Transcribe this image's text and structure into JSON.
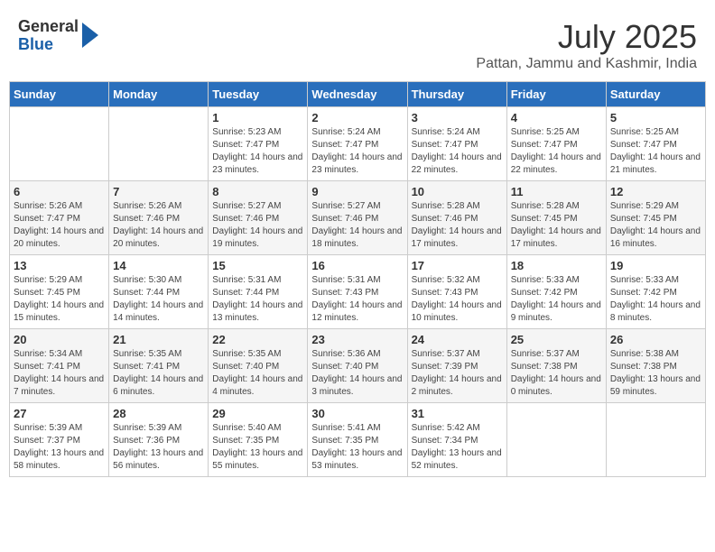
{
  "header": {
    "logo_general": "General",
    "logo_blue": "Blue",
    "title": "July 2025",
    "location": "Pattan, Jammu and Kashmir, India"
  },
  "calendar": {
    "days_of_week": [
      "Sunday",
      "Monday",
      "Tuesday",
      "Wednesday",
      "Thursday",
      "Friday",
      "Saturday"
    ],
    "weeks": [
      [
        {
          "day": "",
          "info": ""
        },
        {
          "day": "",
          "info": ""
        },
        {
          "day": "1",
          "info": "Sunrise: 5:23 AM\nSunset: 7:47 PM\nDaylight: 14 hours and 23 minutes."
        },
        {
          "day": "2",
          "info": "Sunrise: 5:24 AM\nSunset: 7:47 PM\nDaylight: 14 hours and 23 minutes."
        },
        {
          "day": "3",
          "info": "Sunrise: 5:24 AM\nSunset: 7:47 PM\nDaylight: 14 hours and 22 minutes."
        },
        {
          "day": "4",
          "info": "Sunrise: 5:25 AM\nSunset: 7:47 PM\nDaylight: 14 hours and 22 minutes."
        },
        {
          "day": "5",
          "info": "Sunrise: 5:25 AM\nSunset: 7:47 PM\nDaylight: 14 hours and 21 minutes."
        }
      ],
      [
        {
          "day": "6",
          "info": "Sunrise: 5:26 AM\nSunset: 7:47 PM\nDaylight: 14 hours and 20 minutes."
        },
        {
          "day": "7",
          "info": "Sunrise: 5:26 AM\nSunset: 7:46 PM\nDaylight: 14 hours and 20 minutes."
        },
        {
          "day": "8",
          "info": "Sunrise: 5:27 AM\nSunset: 7:46 PM\nDaylight: 14 hours and 19 minutes."
        },
        {
          "day": "9",
          "info": "Sunrise: 5:27 AM\nSunset: 7:46 PM\nDaylight: 14 hours and 18 minutes."
        },
        {
          "day": "10",
          "info": "Sunrise: 5:28 AM\nSunset: 7:46 PM\nDaylight: 14 hours and 17 minutes."
        },
        {
          "day": "11",
          "info": "Sunrise: 5:28 AM\nSunset: 7:45 PM\nDaylight: 14 hours and 17 minutes."
        },
        {
          "day": "12",
          "info": "Sunrise: 5:29 AM\nSunset: 7:45 PM\nDaylight: 14 hours and 16 minutes."
        }
      ],
      [
        {
          "day": "13",
          "info": "Sunrise: 5:29 AM\nSunset: 7:45 PM\nDaylight: 14 hours and 15 minutes."
        },
        {
          "day": "14",
          "info": "Sunrise: 5:30 AM\nSunset: 7:44 PM\nDaylight: 14 hours and 14 minutes."
        },
        {
          "day": "15",
          "info": "Sunrise: 5:31 AM\nSunset: 7:44 PM\nDaylight: 14 hours and 13 minutes."
        },
        {
          "day": "16",
          "info": "Sunrise: 5:31 AM\nSunset: 7:43 PM\nDaylight: 14 hours and 12 minutes."
        },
        {
          "day": "17",
          "info": "Sunrise: 5:32 AM\nSunset: 7:43 PM\nDaylight: 14 hours and 10 minutes."
        },
        {
          "day": "18",
          "info": "Sunrise: 5:33 AM\nSunset: 7:42 PM\nDaylight: 14 hours and 9 minutes."
        },
        {
          "day": "19",
          "info": "Sunrise: 5:33 AM\nSunset: 7:42 PM\nDaylight: 14 hours and 8 minutes."
        }
      ],
      [
        {
          "day": "20",
          "info": "Sunrise: 5:34 AM\nSunset: 7:41 PM\nDaylight: 14 hours and 7 minutes."
        },
        {
          "day": "21",
          "info": "Sunrise: 5:35 AM\nSunset: 7:41 PM\nDaylight: 14 hours and 6 minutes."
        },
        {
          "day": "22",
          "info": "Sunrise: 5:35 AM\nSunset: 7:40 PM\nDaylight: 14 hours and 4 minutes."
        },
        {
          "day": "23",
          "info": "Sunrise: 5:36 AM\nSunset: 7:40 PM\nDaylight: 14 hours and 3 minutes."
        },
        {
          "day": "24",
          "info": "Sunrise: 5:37 AM\nSunset: 7:39 PM\nDaylight: 14 hours and 2 minutes."
        },
        {
          "day": "25",
          "info": "Sunrise: 5:37 AM\nSunset: 7:38 PM\nDaylight: 14 hours and 0 minutes."
        },
        {
          "day": "26",
          "info": "Sunrise: 5:38 AM\nSunset: 7:38 PM\nDaylight: 13 hours and 59 minutes."
        }
      ],
      [
        {
          "day": "27",
          "info": "Sunrise: 5:39 AM\nSunset: 7:37 PM\nDaylight: 13 hours and 58 minutes."
        },
        {
          "day": "28",
          "info": "Sunrise: 5:39 AM\nSunset: 7:36 PM\nDaylight: 13 hours and 56 minutes."
        },
        {
          "day": "29",
          "info": "Sunrise: 5:40 AM\nSunset: 7:35 PM\nDaylight: 13 hours and 55 minutes."
        },
        {
          "day": "30",
          "info": "Sunrise: 5:41 AM\nSunset: 7:35 PM\nDaylight: 13 hours and 53 minutes."
        },
        {
          "day": "31",
          "info": "Sunrise: 5:42 AM\nSunset: 7:34 PM\nDaylight: 13 hours and 52 minutes."
        },
        {
          "day": "",
          "info": ""
        },
        {
          "day": "",
          "info": ""
        }
      ]
    ]
  }
}
